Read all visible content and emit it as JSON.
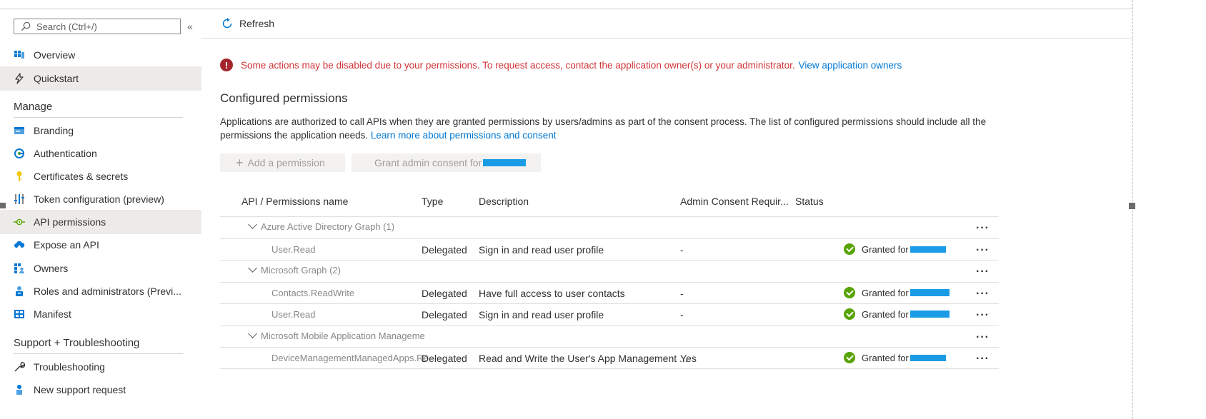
{
  "sidebar": {
    "search_placeholder": "Search (Ctrl+/)",
    "collapse_glyph": "«",
    "top_items": [
      {
        "label": "Overview",
        "icon": "overview-icon"
      },
      {
        "label": "Quickstart",
        "icon": "quickstart-icon",
        "selected": true
      }
    ],
    "sections": [
      {
        "title": "Manage"
      },
      {
        "title": "Support + Troubleshooting"
      }
    ],
    "manage_items": [
      {
        "label": "Branding",
        "icon": "branding-icon"
      },
      {
        "label": "Authentication",
        "icon": "authentication-icon"
      },
      {
        "label": "Certificates & secrets",
        "icon": "key-icon"
      },
      {
        "label": "Token configuration (preview)",
        "icon": "token-icon"
      },
      {
        "label": "API permissions",
        "icon": "api-permissions-icon",
        "selected": true
      },
      {
        "label": "Expose an API",
        "icon": "cloud-icon"
      },
      {
        "label": "Owners",
        "icon": "owners-icon"
      },
      {
        "label": "Roles and administrators (Previ...",
        "icon": "roles-icon"
      },
      {
        "label": "Manifest",
        "icon": "manifest-icon"
      }
    ],
    "support_items": [
      {
        "label": "Troubleshooting",
        "icon": "wrench-icon"
      },
      {
        "label": "New support request",
        "icon": "person-icon"
      }
    ]
  },
  "commandbar": {
    "refresh_label": "Refresh"
  },
  "alert": {
    "message": "Some actions may be disabled due to your permissions. To request access, contact the application owner(s) or your administrator.",
    "link": "View application owners"
  },
  "section": {
    "title": "Configured permissions",
    "description": "Applications are authorized to call APIs when they are granted permissions by users/admins as part of the consent process. The list of configured permissions should include all the permissions the application needs.",
    "learn_more": "Learn more about permissions and consent"
  },
  "actions": {
    "add_label": "Add a permission",
    "grant_label": "Grant admin consent for"
  },
  "table": {
    "headers": [
      "API / Permissions name",
      "Type",
      "Description",
      "Admin Consent Requir...",
      "Status"
    ],
    "groups": [
      {
        "name": "Azure Active Directory Graph (1)",
        "rows": [
          {
            "name": "User.Read",
            "type": "Delegated",
            "description": "Sign in and read user profile",
            "admin": "-",
            "status": "Granted for"
          }
        ]
      },
      {
        "name": "Microsoft Graph (2)",
        "rows": [
          {
            "name": "Contacts.ReadWrite",
            "type": "Delegated",
            "description": "Have full access to user contacts",
            "admin": "-",
            "status": "Granted for"
          },
          {
            "name": "User.Read",
            "type": "Delegated",
            "description": "Sign in and read user profile",
            "admin": "-",
            "status": "Granted for"
          }
        ]
      },
      {
        "name": "Microsoft Mobile Application Manageme",
        "rows": [
          {
            "name": "DeviceManagementManagedApps.Re",
            "type": "Delegated",
            "description": "Read and Write the User's App Management ...",
            "admin": "Yes",
            "status": "Granted for"
          }
        ]
      }
    ],
    "more_glyph": "···"
  },
  "colors": {
    "accent": "#0078d4",
    "error": "#d13438",
    "success": "#57a300",
    "redaction": "#1a9be6",
    "selected_bg": "#edebe9"
  }
}
